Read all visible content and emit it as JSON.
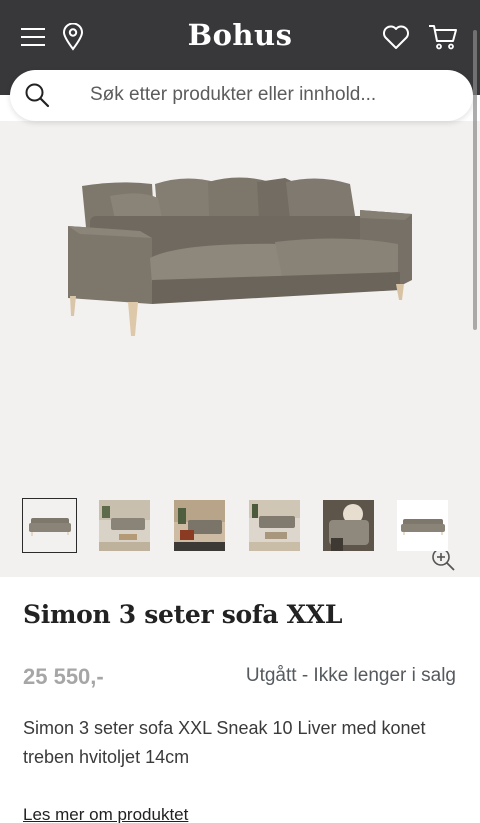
{
  "header": {
    "logo": "Bohus",
    "menu_icon": "hamburger-menu-icon",
    "location_icon": "location-pin-icon",
    "wishlist_icon": "heart-icon",
    "cart_icon": "shopping-cart-icon",
    "background": "#38373a"
  },
  "search": {
    "placeholder": "Søk etter produkter eller innhold..."
  },
  "gallery": {
    "background": "#f3f1ef",
    "zoom_icon": "zoom-in-icon",
    "thumbnails": [
      {
        "name": "sofa studio",
        "active": true
      },
      {
        "name": "living room scene 1",
        "active": false
      },
      {
        "name": "living room scene 2",
        "active": false
      },
      {
        "name": "living room scene 3",
        "active": false
      },
      {
        "name": "detail closeup",
        "active": false
      },
      {
        "name": "sofa small",
        "active": false
      }
    ]
  },
  "product": {
    "title": "Simon 3 seter sofa XXL",
    "price": "25 550,-",
    "status": "Utgått - Ikke lenger i salg",
    "description": "Simon 3 seter sofa XXL Sneak 10 Liver med konet treben hvitoljet 14cm",
    "read_more": "Les mer om produktet"
  }
}
